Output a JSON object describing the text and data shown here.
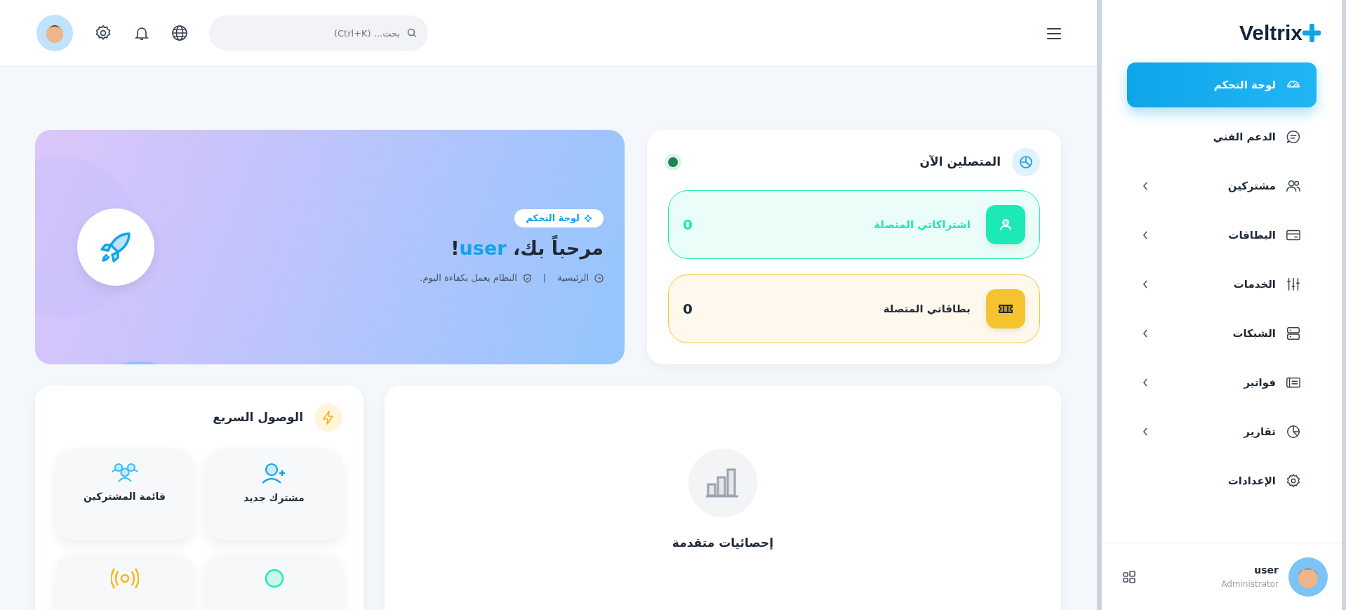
{
  "sidebar": {
    "logo": "Veltrix",
    "items": [
      {
        "label": "لوحة التحكم",
        "selected": true,
        "submenu": false
      },
      {
        "label": "الدعم الفني",
        "selected": false,
        "submenu": false
      },
      {
        "label": "مشتركين",
        "selected": false,
        "submenu": true
      },
      {
        "label": "البطاقات",
        "selected": false,
        "submenu": true
      },
      {
        "label": "الخدمات",
        "selected": false,
        "submenu": true
      },
      {
        "label": "الشبكات",
        "selected": false,
        "submenu": true
      },
      {
        "label": "فواتير",
        "selected": false,
        "submenu": true
      },
      {
        "label": "تقارير",
        "selected": false,
        "submenu": true
      },
      {
        "label": "الإعدادات",
        "selected": false,
        "submenu": false
      }
    ],
    "user": {
      "name": "user",
      "role": "Administrator"
    }
  },
  "topbar": {
    "search": {
      "placeholder": "بحث... (Ctrl+K)"
    }
  },
  "hero": {
    "badge": "لوحة التحكم",
    "greeting": "مرحباً بك، ",
    "username": "user",
    "exclaim": "!",
    "breadcrumb": "الرئيسية",
    "separator": "|",
    "status": "النظام يعمل بكفاءة اليوم."
  },
  "connected": {
    "title": "المتصلين الآن",
    "online": true,
    "metrics": [
      {
        "label": "اشتراكاتي المتصلة",
        "value": "0",
        "color": "#1de9b6"
      },
      {
        "label": "بطاقاتي المتصلة",
        "value": "0",
        "color": "#f4c430"
      }
    ]
  },
  "quick_access": {
    "title": "الوصول السريع",
    "items": [
      {
        "label": "مشترك جديد"
      },
      {
        "label": "قائمة المشتركين"
      }
    ]
  },
  "stats": {
    "title": "إحصائيات متقدمة"
  }
}
